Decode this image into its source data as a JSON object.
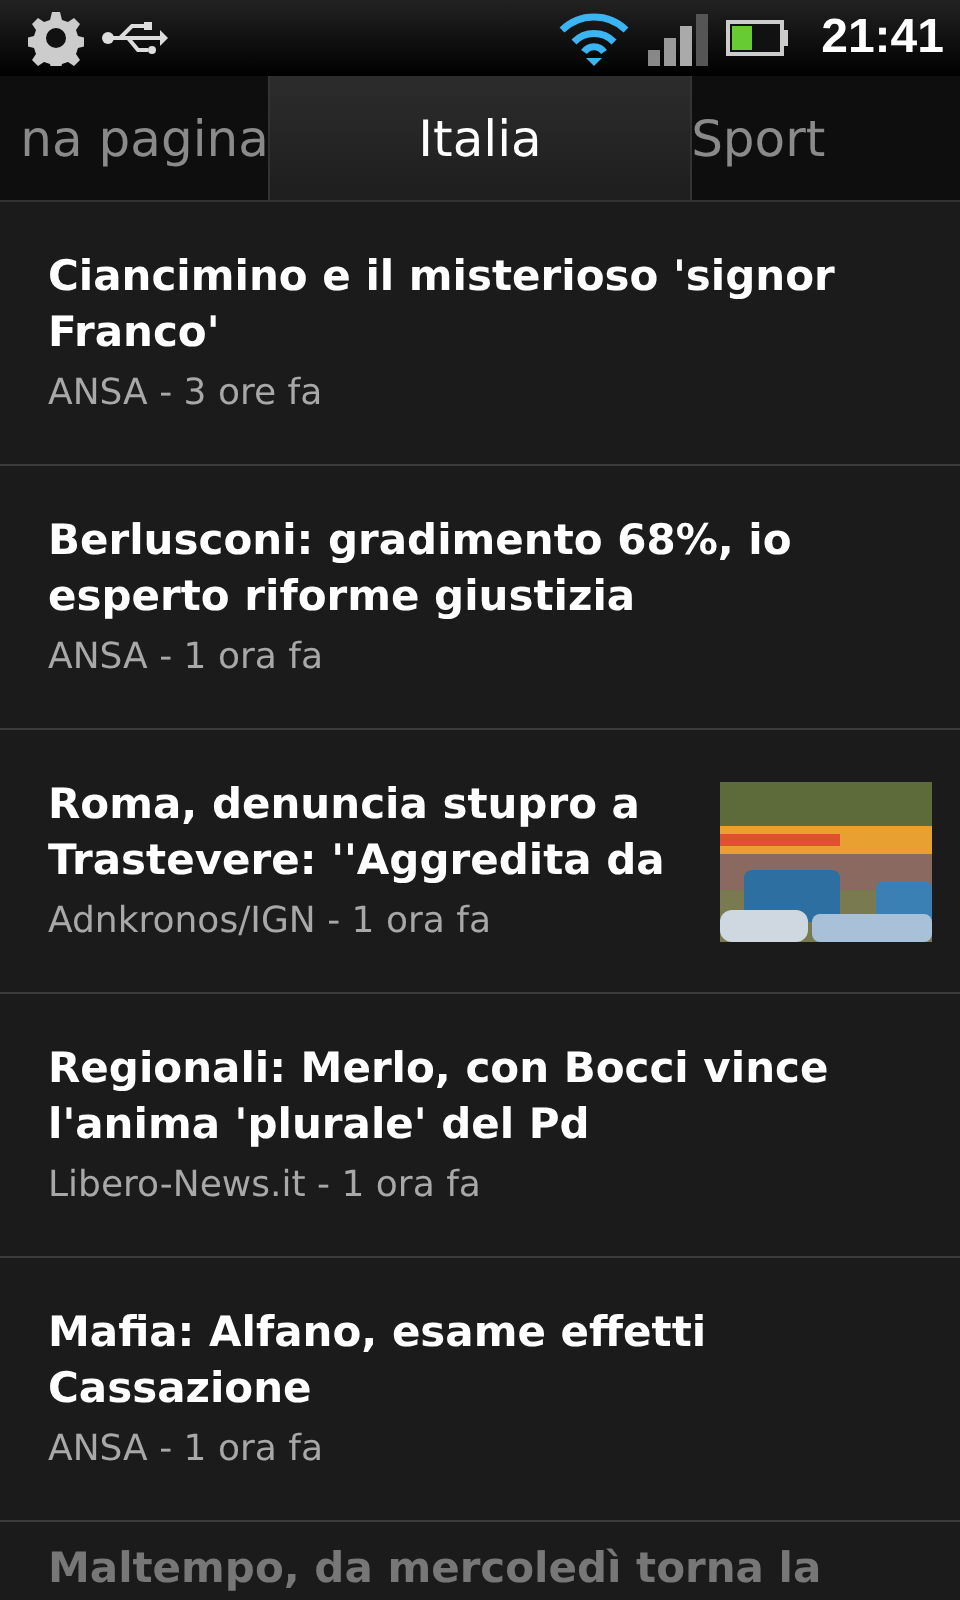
{
  "status_bar": {
    "time": "21:41"
  },
  "tabs": [
    {
      "label": "na pagina",
      "selected": false
    },
    {
      "label": "Italia",
      "selected": true
    },
    {
      "label": "Sport",
      "selected": false
    }
  ],
  "articles": [
    {
      "title": "Ciancimino e il misterioso 'signor Franco'",
      "source": "ANSA - 3 ore fa"
    },
    {
      "title": "Berlusconi: gradimento 68%, io esperto riforme giustizia",
      "source": "ANSA - 1 ora fa"
    },
    {
      "title": "Roma, denuncia stupro a Trastevere: ''Aggredita da",
      "source": "Adnkronos/IGN - 1 ora fa"
    },
    {
      "title": "Regionali: Merlo, con Bocci vince l'anima 'plurale' del Pd",
      "source": "Libero-News.it - 1 ora fa"
    },
    {
      "title": "Mafia: Alfano, esame effetti Cassazione",
      "source": "ANSA - 1 ora fa"
    },
    {
      "title": "Maltempo, da mercoledì torna la"
    }
  ]
}
